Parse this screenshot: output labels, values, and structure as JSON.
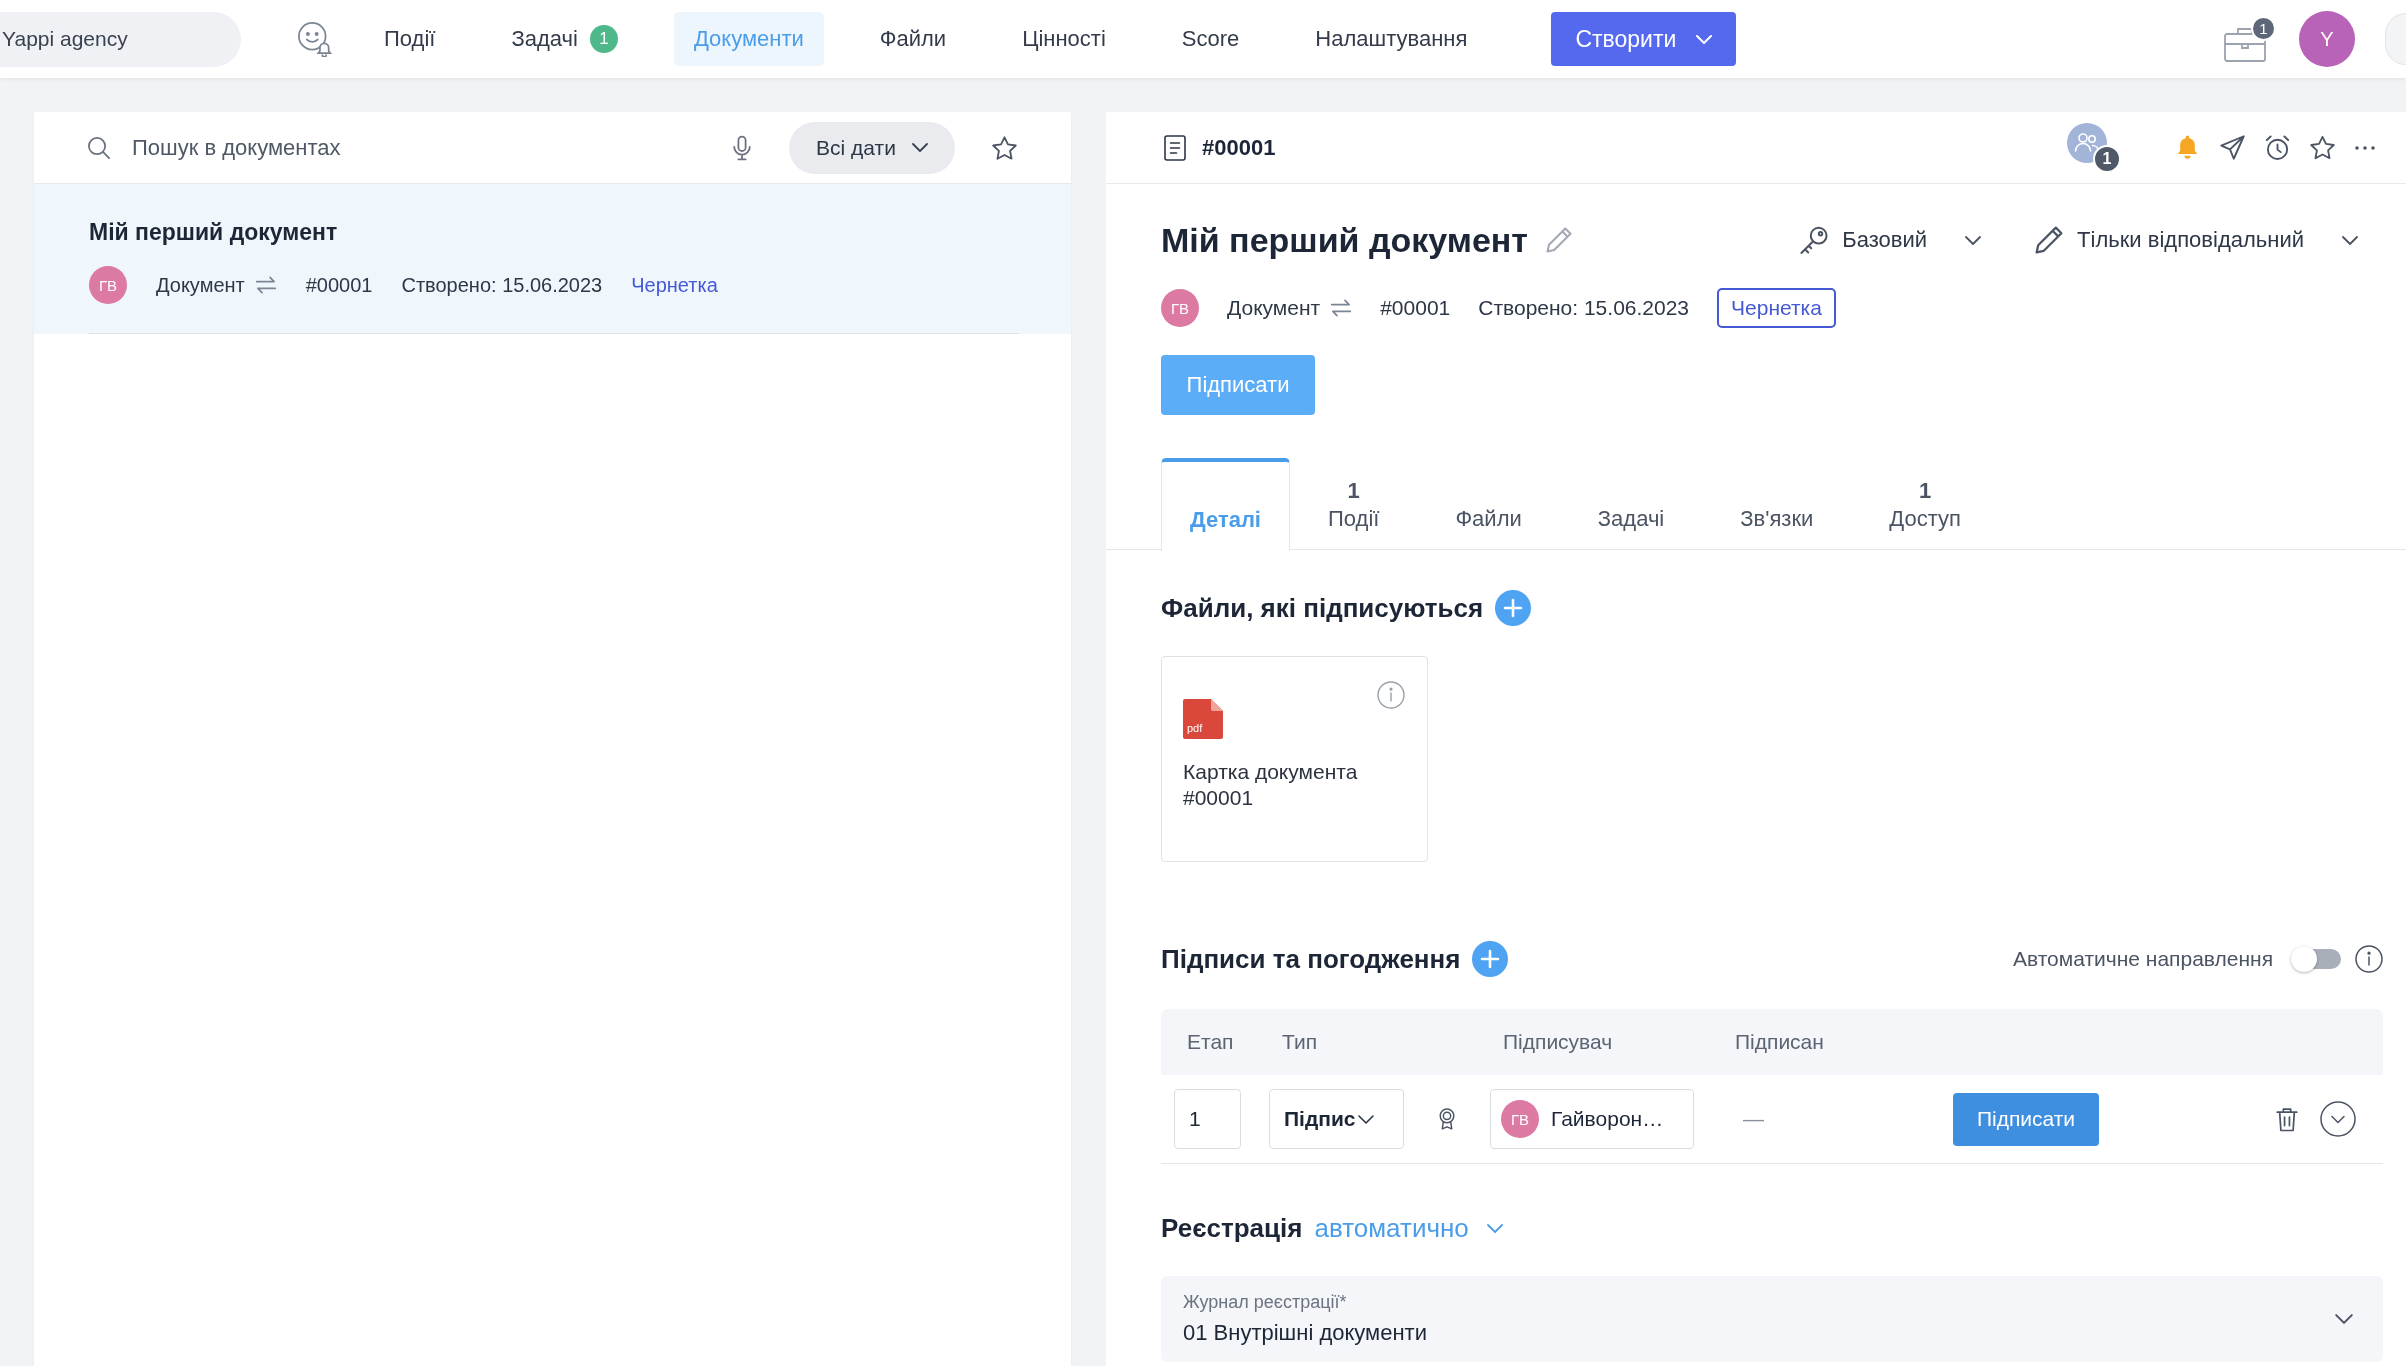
{
  "topbar": {
    "workspace": "Yappi agency",
    "nav": [
      {
        "label": "Події",
        "selected": false
      },
      {
        "label": "Задачі",
        "badge": "1",
        "selected": false
      },
      {
        "label": "Документи",
        "selected": true
      },
      {
        "label": "Файли",
        "selected": false
      },
      {
        "label": "Цінності",
        "selected": false
      },
      {
        "label": "Score",
        "selected": false
      },
      {
        "label": "Налаштування",
        "selected": false
      }
    ],
    "create_button": "Створити",
    "briefcase_badge": "1",
    "avatar": "Y"
  },
  "list_panel": {
    "search": {
      "placeholder": "Пошук в документах"
    },
    "date_filter": "Всі дати",
    "items": [
      {
        "title": "Мій перший документ",
        "author": "ГВ",
        "type": "Документ",
        "number": "#00001",
        "created": "Створено: 15.06.2023",
        "status": "Чернетка",
        "selected": true
      }
    ]
  },
  "document": {
    "number": "#00001",
    "participants_badge": "1",
    "title": "Мій перший документ",
    "access": "Базовий",
    "edit_rights": "Тільки відповідальний",
    "author": "ГВ",
    "type": "Документ",
    "doc_number": "#00001",
    "created": "Створено: 15.06.2023",
    "status": "Чернетка",
    "sign_button": "Підписати",
    "tabs": [
      {
        "label": "Деталі",
        "selected": true
      },
      {
        "count": "1",
        "label": "Події",
        "selected": false
      },
      {
        "label": "Файли",
        "selected": false
      },
      {
        "label": "Задачі",
        "selected": false
      },
      {
        "label": "Зв'язки",
        "selected": false
      },
      {
        "count": "1",
        "label": "Доступ",
        "selected": false
      }
    ],
    "files": {
      "title": "Файли, які підписуються",
      "items": [
        {
          "file_type": "pdf",
          "name": "Картка документа #00001"
        }
      ]
    },
    "signatures": {
      "title": "Підписи та погодження",
      "auto_routing": {
        "label": "Автоматичне направлення",
        "on": false
      },
      "columns": [
        "Етап",
        "Тип",
        "Підписувач",
        "Підписан"
      ],
      "rows": [
        {
          "stage": "1",
          "type": "Підпис",
          "signer_initials": "ГВ",
          "signer": "Гайворон…",
          "signed": "—",
          "action": "Підписати"
        }
      ]
    },
    "registration": {
      "title": "Реєстрація",
      "mode": "автоматично",
      "journal": {
        "label": "Журнал реєстрації*",
        "value": "01 Внутрішні документи"
      }
    }
  }
}
